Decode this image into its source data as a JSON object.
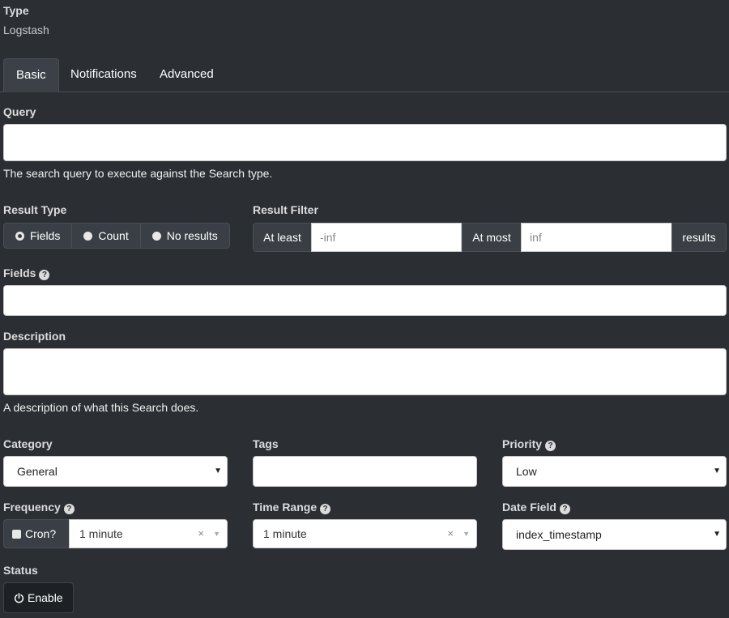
{
  "type": {
    "label": "Type",
    "value": "Logstash"
  },
  "tabs": [
    {
      "label": "Basic",
      "active": true
    },
    {
      "label": "Notifications",
      "active": false
    },
    {
      "label": "Advanced",
      "active": false
    }
  ],
  "query": {
    "label": "Query",
    "value": "",
    "help": "The search query to execute against the Search type."
  },
  "result_type": {
    "label": "Result Type",
    "options": [
      {
        "label": "Fields",
        "checked": true
      },
      {
        "label": "Count",
        "checked": false
      },
      {
        "label": "No results",
        "checked": false
      }
    ]
  },
  "result_filter": {
    "label": "Result Filter",
    "at_least_label": "At least",
    "at_least_placeholder": "-inf",
    "at_most_label": "At most",
    "at_most_placeholder": "inf",
    "results_label": "results"
  },
  "fields": {
    "label": "Fields",
    "value": ""
  },
  "description": {
    "label": "Description",
    "value": "",
    "help": "A description of what this Search does."
  },
  "category": {
    "label": "Category",
    "selected": "General"
  },
  "tags": {
    "label": "Tags",
    "value": ""
  },
  "priority": {
    "label": "Priority",
    "selected": "Low"
  },
  "frequency": {
    "label": "Frequency",
    "cron_label": "Cron?",
    "selected": "1 minute"
  },
  "time_range": {
    "label": "Time Range",
    "selected": "1 minute"
  },
  "date_field": {
    "label": "Date Field",
    "selected": "index_timestamp"
  },
  "status": {
    "label": "Status",
    "button_label": "Enable"
  },
  "glyphs": {
    "help": "?",
    "caret": "▼",
    "clear": "×",
    "dropdown": "▼"
  },
  "icons": [
    "question-circle-icon",
    "power-icon",
    "caret-down-icon",
    "clear-icon"
  ]
}
